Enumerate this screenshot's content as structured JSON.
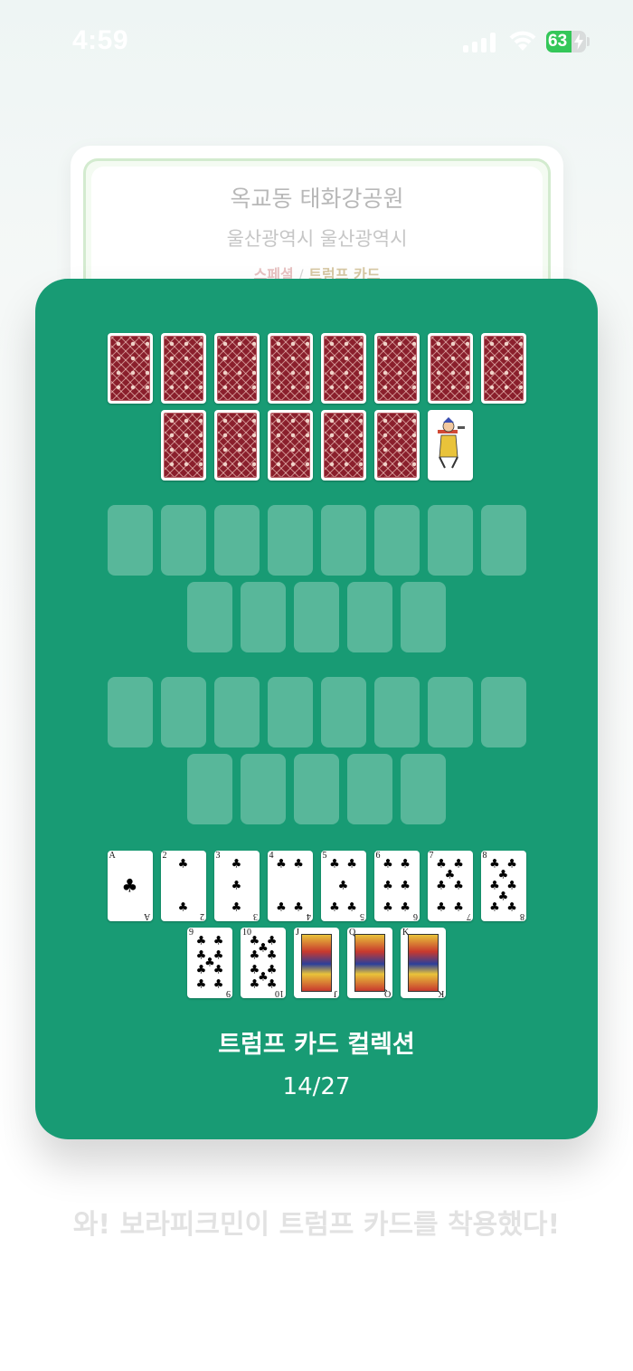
{
  "status_bar": {
    "time": "4:59",
    "battery_level": "63",
    "battery_fraction": 0.63,
    "icons": [
      "signal-icon",
      "wifi-icon",
      "battery-charging-icon"
    ]
  },
  "location": {
    "name": "옥교동 태화강공원",
    "region": "울산광역시 울산광역시",
    "tag_special": "스페셜",
    "tag_separator": "/",
    "tag_category": "트럼프 카드"
  },
  "collection": {
    "title": "트럼프 카드 컬렉션",
    "count": "14/27",
    "colors": {
      "background": "#189b74",
      "card_back": "#8a1f2c"
    },
    "sections": [
      {
        "rows": [
          8,
          6
        ],
        "cards": [
          {
            "kind": "back"
          },
          {
            "kind": "back"
          },
          {
            "kind": "back"
          },
          {
            "kind": "back"
          },
          {
            "kind": "back"
          },
          {
            "kind": "back"
          },
          {
            "kind": "back"
          },
          {
            "kind": "back"
          },
          {
            "kind": "back"
          },
          {
            "kind": "back"
          },
          {
            "kind": "back"
          },
          {
            "kind": "back"
          },
          {
            "kind": "back"
          },
          {
            "kind": "joker"
          }
        ]
      },
      {
        "rows": [
          8,
          5
        ],
        "cards": [
          {
            "kind": "slot"
          },
          {
            "kind": "slot"
          },
          {
            "kind": "slot"
          },
          {
            "kind": "slot"
          },
          {
            "kind": "slot"
          },
          {
            "kind": "slot"
          },
          {
            "kind": "slot"
          },
          {
            "kind": "slot"
          },
          {
            "kind": "slot"
          },
          {
            "kind": "slot"
          },
          {
            "kind": "slot"
          },
          {
            "kind": "slot"
          },
          {
            "kind": "slot"
          }
        ]
      },
      {
        "rows": [
          8,
          5
        ],
        "cards": [
          {
            "kind": "slot"
          },
          {
            "kind": "slot"
          },
          {
            "kind": "slot"
          },
          {
            "kind": "slot"
          },
          {
            "kind": "slot"
          },
          {
            "kind": "slot"
          },
          {
            "kind": "slot"
          },
          {
            "kind": "slot"
          },
          {
            "kind": "slot"
          },
          {
            "kind": "slot"
          },
          {
            "kind": "slot"
          },
          {
            "kind": "slot"
          },
          {
            "kind": "slot"
          }
        ]
      },
      {
        "rows": [
          8,
          5
        ],
        "cards": [
          {
            "kind": "pip",
            "rank": "A",
            "suit": "♣",
            "pips": 1
          },
          {
            "kind": "pip",
            "rank": "2",
            "suit": "♣",
            "pips": 2
          },
          {
            "kind": "pip",
            "rank": "3",
            "suit": "♣",
            "pips": 3
          },
          {
            "kind": "pip",
            "rank": "4",
            "suit": "♣",
            "pips": 4
          },
          {
            "kind": "pip",
            "rank": "5",
            "suit": "♣",
            "pips": 5
          },
          {
            "kind": "pip",
            "rank": "6",
            "suit": "♣",
            "pips": 6
          },
          {
            "kind": "pip",
            "rank": "7",
            "suit": "♣",
            "pips": 7
          },
          {
            "kind": "pip",
            "rank": "8",
            "suit": "♣",
            "pips": 8
          },
          {
            "kind": "pip",
            "rank": "9",
            "suit": "♣",
            "pips": 9
          },
          {
            "kind": "pip",
            "rank": "10",
            "suit": "♣",
            "pips": 10
          },
          {
            "kind": "face",
            "rank": "J",
            "suit": "♣"
          },
          {
            "kind": "face",
            "rank": "Q",
            "suit": "♣"
          },
          {
            "kind": "face",
            "rank": "K",
            "suit": "♣"
          }
        ]
      }
    ]
  },
  "message": "와! 보라피크민이 트럼프 카드를 착용했다!"
}
